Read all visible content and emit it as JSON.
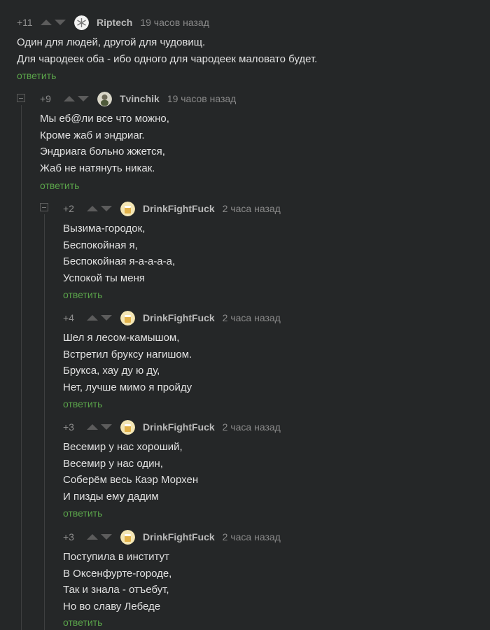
{
  "comments": [
    {
      "rating": "+11",
      "author": "Riptech",
      "time": "19 часов назад",
      "avatar_icon": "snowflake-avatar-icon",
      "lines": [
        "Один для людей, другой для чудовищ.",
        "Для чародеек оба - ибо одного для чародеек маловато будет."
      ],
      "reply": "ответить"
    },
    {
      "rating": "+9",
      "author": "Tvinchik",
      "time": "19 часов назад",
      "avatar_icon": "character-avatar-icon",
      "lines": [
        "Мы еб@ли все что можно,",
        "Кроме жаб и эндриаг.",
        "Эндриага больно жжется,",
        "Жаб не натянуть никак."
      ],
      "reply": "ответить"
    },
    {
      "rating": "+2",
      "author": "DrinkFightFuck",
      "time": "2 часа назад",
      "avatar_icon": "beer-avatar-icon",
      "lines": [
        "Вызима-городок,",
        "Беспокойная я,",
        "Беспокойная я-а-а-а-а,",
        "Успокой ты меня"
      ],
      "reply": "ответить"
    },
    {
      "rating": "+4",
      "author": "DrinkFightFuck",
      "time": "2 часа назад",
      "avatar_icon": "beer-avatar-icon",
      "lines": [
        "Шел я лесом-камышом,",
        "Встретил бруксу нагишом.",
        "Брукса, хау ду ю ду,",
        "Нет, лучше мимо я пройду"
      ],
      "reply": "ответить"
    },
    {
      "rating": "+3",
      "author": "DrinkFightFuck",
      "time": "2 часа назад",
      "avatar_icon": "beer-avatar-icon",
      "lines": [
        "Весемир у нас хороший,",
        "Весемир у нас один,",
        "Соберём весь Каэр Морхен",
        "И пизды ему дадим"
      ],
      "reply": "ответить"
    },
    {
      "rating": "+3",
      "author": "DrinkFightFuck",
      "time": "2 часа назад",
      "avatar_icon": "beer-avatar-icon",
      "lines": [
        "Поступила в институт",
        "В Оксенфурте-городе,",
        "Так и знала - отъебут,",
        "Но во славу Лебеде"
      ],
      "reply": "ответить"
    }
  ],
  "colors": {
    "background": "#252728",
    "reply_link": "#5aa34a",
    "text": "#e1e1e1",
    "meta": "#8a8a8a"
  }
}
